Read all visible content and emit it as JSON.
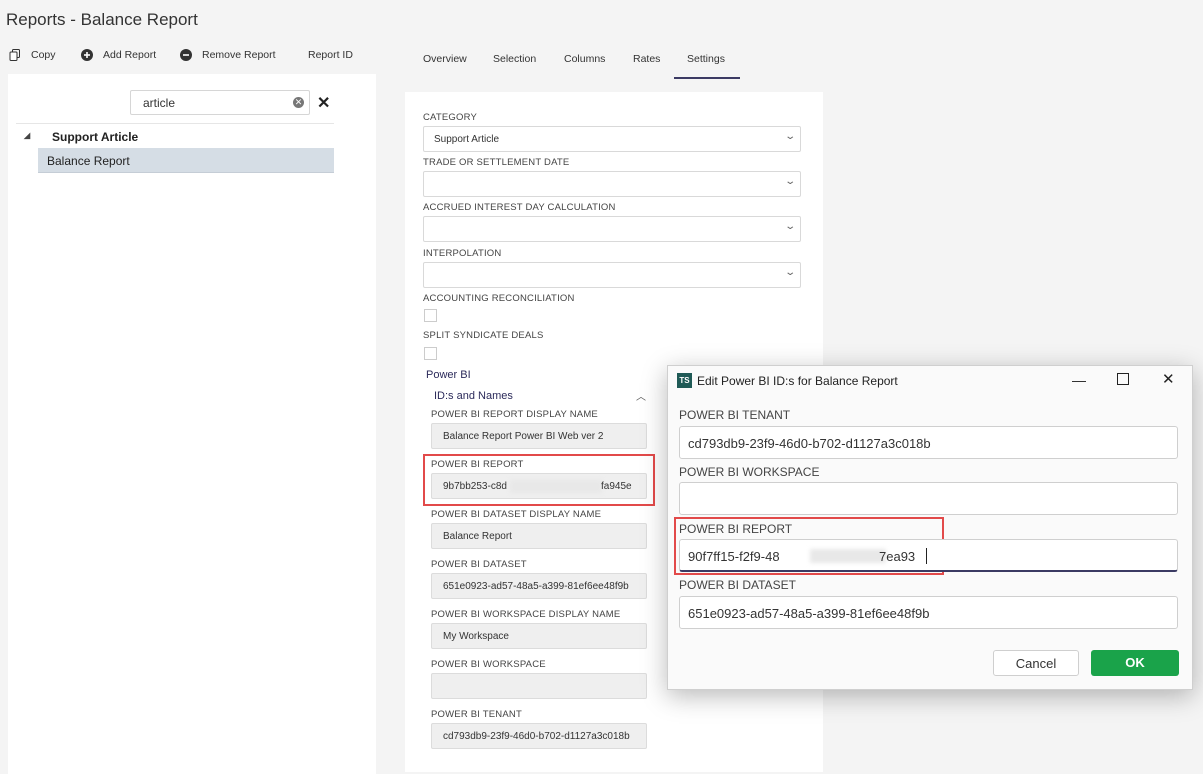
{
  "window": {
    "title": "Reports - Balance Report"
  },
  "toolbar": {
    "copy": "Copy",
    "add": "Add Report",
    "remove": "Remove Report",
    "report_id": "Report ID"
  },
  "left": {
    "search_value": "article",
    "tree_header": "Support Article",
    "tree_item": "Balance Report"
  },
  "tabs": {
    "overview": "Overview",
    "selection": "Selection",
    "columns": "Columns",
    "rates": "Rates",
    "settings": "Settings",
    "active": "Settings"
  },
  "settings": {
    "category_label": "CATEGORY",
    "category_value": "Support Article",
    "trade_label": "TRADE OR SETTLEMENT DATE",
    "accrued_label": "ACCRUED INTEREST DAY CALCULATION",
    "interp_label": "INTERPOLATION",
    "accounting_label": "ACCOUNTING RECONCILIATION",
    "split_label": "SPLIT SYNDICATE DEALS",
    "powerbi_header": "Power BI",
    "ids_header": "ID:s and Names",
    "report_display_label": "POWER BI REPORT DISPLAY NAME",
    "report_display_value": "Balance Report Power BI Web ver 2",
    "report_label": "POWER BI REPORT",
    "report_value_start": "9b7bb253-c8d",
    "report_value_end": "fa945e",
    "dataset_display_label": "POWER BI DATASET DISPLAY NAME",
    "dataset_display_value": "Balance Report",
    "dataset_label": "POWER BI DATASET",
    "dataset_value": "651e0923-ad57-48a5-a399-81ef6ee48f9b",
    "workspace_display_label": "POWER BI WORKSPACE DISPLAY NAME",
    "workspace_display_value": "My Workspace",
    "workspace_label": "POWER BI WORKSPACE",
    "workspace_value": "",
    "tenant_label": "POWER BI TENANT",
    "tenant_value": "cd793db9-23f9-46d0-b702-d1127a3c018b"
  },
  "dialog": {
    "app_badge": "TS",
    "title": "Edit Power BI ID:s for Balance Report",
    "tenant_label": "POWER BI TENANT",
    "tenant_value": "cd793db9-23f9-46d0-b702-d1127a3c018b",
    "workspace_label": "POWER BI WORKSPACE",
    "workspace_value": "",
    "report_label": "POWER BI REPORT",
    "report_value_start": "90f7ff15-f2f9-48",
    "report_value_end": "7ea93",
    "dataset_label": "POWER BI DATASET",
    "dataset_value": "651e0923-ad57-48a5-a399-81ef6ee48f9b",
    "cancel": "Cancel",
    "ok": "OK"
  },
  "colors": {
    "accent": "#3b3a63",
    "ok_green": "#1aa34a",
    "highlight_red": "#e24a4a",
    "selected_row": "#d5dde5"
  }
}
